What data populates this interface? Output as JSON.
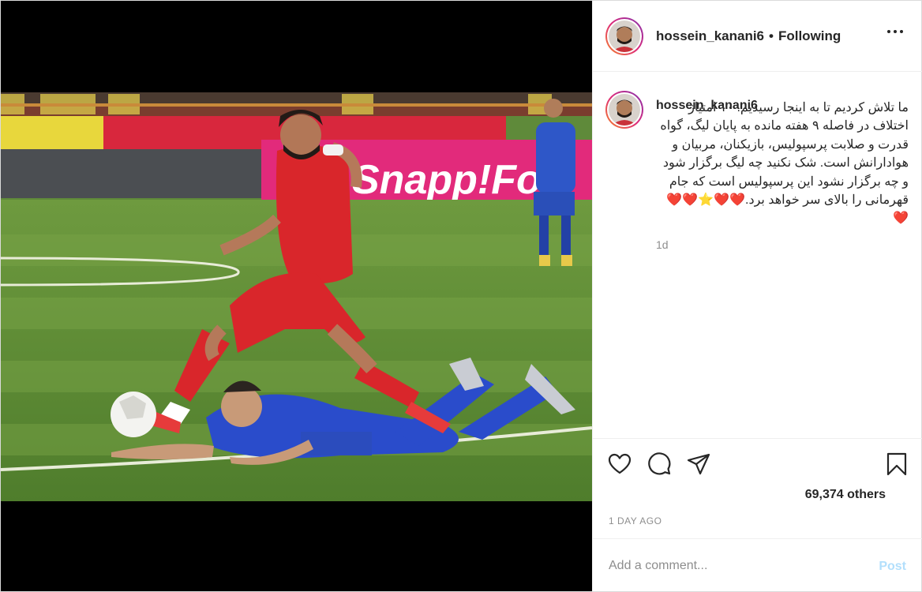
{
  "post": {
    "author": {
      "username": "hossein_kanani6",
      "separator": "•",
      "follow_status": "Following"
    },
    "media": {
      "alt": "Football match photo: player in red kit hurdles over a player in blue kit sliding on the grass",
      "banner_text": "Snapp!Fo"
    },
    "caption": {
      "username": "hossein_kanani6",
      "text": "ما تلاش کردیم تا به اینجا رسیدیم. ۱۰ امتیاز اختلاف در فاصله ۹ هفته مانده به پایان لیگ، گواه قدرت و صلابت پرسپولیس، بازیکنان، مربیان و هوادارانش است. شک نکنید چه لیگ برگزار شود و چه برگزار نشود این پرسپولیس است که جام قهرمانی را بالای سر خواهد برد.❤️❤️⭐❤️❤️❤️",
      "time": "1d"
    },
    "actions": {
      "like_icon": "heart-icon",
      "comment_icon": "comment-icon",
      "share_icon": "share-icon",
      "save_icon": "bookmark-icon"
    },
    "likes": "69,374 others",
    "time_ago": "1 DAY AGO",
    "comment": {
      "placeholder": "Add a comment...",
      "post_label": "Post"
    }
  }
}
